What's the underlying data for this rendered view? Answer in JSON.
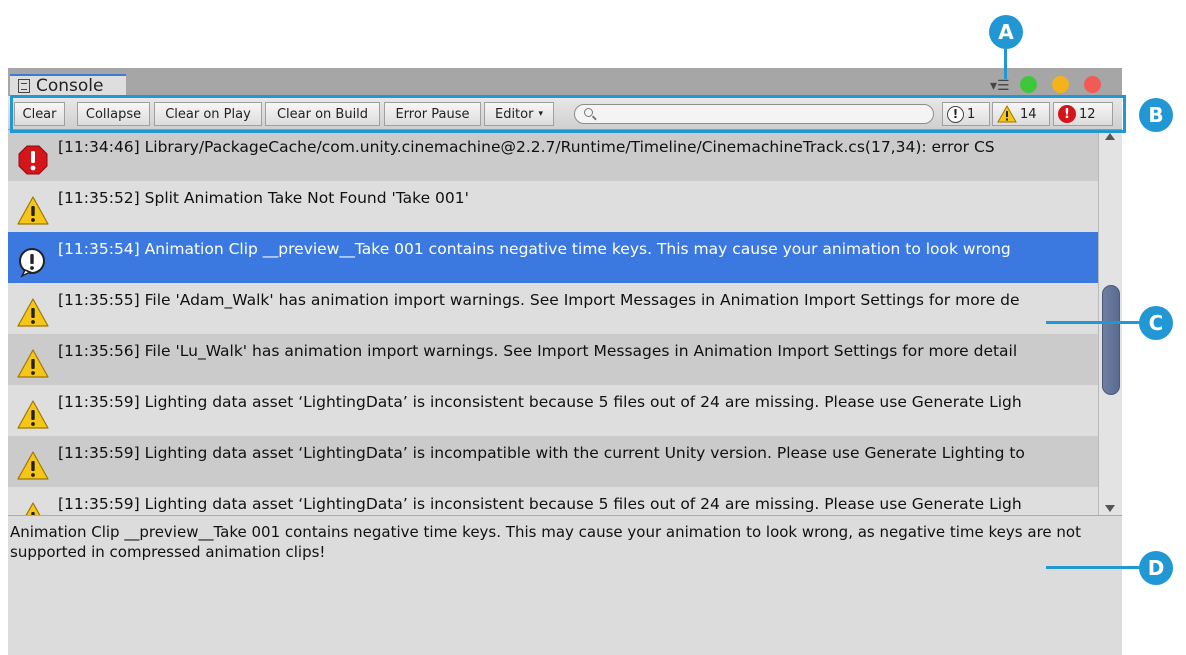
{
  "window": {
    "tab_label": "Console"
  },
  "toolbar": {
    "buttons": [
      "Clear",
      "Collapse",
      "Clear on Play",
      "Clear on Build",
      "Error Pause",
      "Editor"
    ],
    "editor_dropdown_arrow": "▾",
    "search_placeholder": "",
    "counts": {
      "info": "1",
      "warning": "14",
      "error": "12"
    }
  },
  "log": {
    "entries": [
      {
        "type": "error",
        "text": "[11:34:46] Library/PackageCache/com.unity.cinemachine@2.2.7/Runtime/Timeline/CinemachineTrack.cs(17,34): error CS"
      },
      {
        "type": "warning",
        "text": "[11:35:52] Split Animation Take Not Found 'Take 001'"
      },
      {
        "type": "info",
        "text": "[11:35:54] Animation Clip __preview__Take 001 contains negative time keys. This may cause your animation to look wrong",
        "selected": true
      },
      {
        "type": "warning",
        "text": "[11:35:55] File 'Adam_Walk' has animation import warnings. See Import Messages in Animation Import Settings for more de"
      },
      {
        "type": "warning",
        "text": "[11:35:56] File 'Lu_Walk' has animation import warnings. See Import Messages in Animation Import Settings for more detail"
      },
      {
        "type": "warning",
        "text": "[11:35:59] Lighting data asset ‘LightingData’ is inconsistent because 5 files out of 24 are missing.  Please use Generate Ligh"
      },
      {
        "type": "warning",
        "text": "[11:35:59] Lighting data asset ‘LightingData’ is incompatible with the current Unity version. Please use Generate Lighting to"
      },
      {
        "type": "warning",
        "text": "[11:35:59] Lighting data asset ‘LightingData’ is inconsistent because 5 files out of 24 are missing.  Please use Generate Ligh"
      }
    ]
  },
  "detail": {
    "text": "Animation Clip __preview__Take 001 contains negative time keys. This may cause your animation to look wrong, as negative time keys are not supported in compressed animation clips!"
  },
  "callouts": {
    "a": "A",
    "b": "B",
    "c": "C",
    "d": "D"
  },
  "colors": {
    "callout": "#2197d3",
    "selection": "#3b79e0",
    "error_icon": "#d4151a",
    "warning_icon": "#f5c518"
  }
}
